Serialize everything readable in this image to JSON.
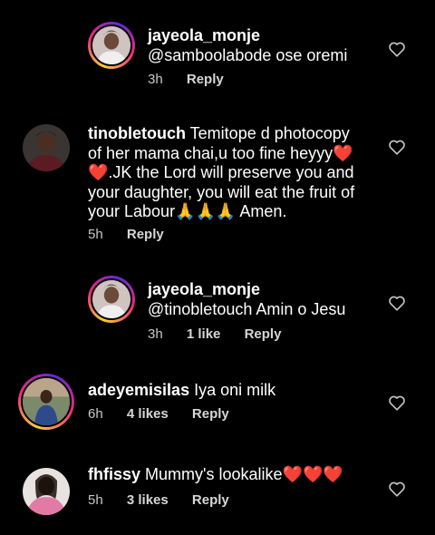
{
  "comments": [
    {
      "username": "jayeola_monje",
      "text": "@samboolabode ose oremi",
      "time": "3h",
      "likes": "",
      "reply_label": "Reply"
    },
    {
      "username": "tinobletouch",
      "text_parts": [
        "Temitope d photocopy of her mama chai,u too fine heyyy",
        "❤️",
        "❤️",
        ".JK the Lord will preserve you and your daughter, you will eat the fruit of your Labour",
        "🙏",
        "🙏",
        "🙏",
        " Amen."
      ],
      "time": "5h",
      "likes": "",
      "reply_label": "Reply"
    },
    {
      "username": "jayeola_monje",
      "text": "@tinobletouch Amin o Jesu",
      "time": "3h",
      "likes": "1 like",
      "reply_label": "Reply"
    },
    {
      "username": "adeyemisilas",
      "text": "Iya oni milk",
      "time": "6h",
      "likes": "4 likes",
      "reply_label": "Reply"
    },
    {
      "username": "fhfissy",
      "text_parts": [
        "Mummy's lookalike",
        "❤️",
        "❤️",
        "❤️"
      ],
      "time": "5h",
      "likes": "3 likes",
      "reply_label": "Reply"
    }
  ],
  "colors": {
    "background": "#000000",
    "text": "#ffffff",
    "meta": "#c7c7c7",
    "story_ring": "#ee2a7b"
  },
  "icons": {
    "like": "heart-outline-icon"
  }
}
